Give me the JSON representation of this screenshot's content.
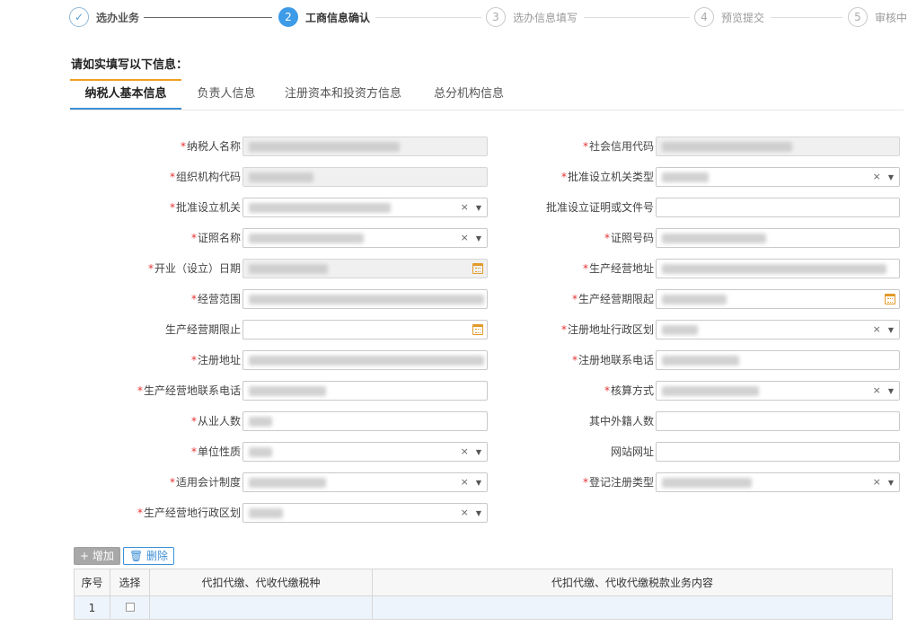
{
  "stepper": {
    "steps": [
      {
        "index": "✓",
        "label": "选办业务",
        "state": "done"
      },
      {
        "index": "2",
        "label": "工商信息确认",
        "state": "active"
      },
      {
        "index": "3",
        "label": "选办信息填写",
        "state": "pending"
      },
      {
        "index": "4",
        "label": "预览提交",
        "state": "pending"
      },
      {
        "index": "5",
        "label": "审核中",
        "state": "pending"
      }
    ]
  },
  "form_title": "请如实填写以下信息：",
  "tabs": [
    {
      "label": "纳税人基本信息",
      "active": true
    },
    {
      "label": "负责人信息",
      "active": false
    },
    {
      "label": "注册资本和投资方信息",
      "active": false
    },
    {
      "label": "总分机构信息",
      "active": false
    }
  ],
  "fields": {
    "taxpayer_name": {
      "label": "纳税人名称",
      "required": true,
      "type": "text",
      "disabled": true
    },
    "credit_code": {
      "label": "社会信用代码",
      "required": true,
      "type": "text",
      "disabled": true
    },
    "org_code": {
      "label": "组织机构代码",
      "required": true,
      "type": "text",
      "disabled": true
    },
    "approval_org_type": {
      "label": "批准设立机关类型",
      "required": true,
      "type": "select"
    },
    "approval_org": {
      "label": "批准设立机关",
      "required": true,
      "type": "select"
    },
    "approval_doc_no": {
      "label": "批准设立证明或文件号",
      "required": false,
      "type": "text"
    },
    "license_name": {
      "label": "证照名称",
      "required": true,
      "type": "select"
    },
    "license_no": {
      "label": "证照号码",
      "required": true,
      "type": "text"
    },
    "open_date": {
      "label": "开业（设立）日期",
      "required": true,
      "type": "date",
      "disabled": true
    },
    "business_address": {
      "label": "生产经营地址",
      "required": true,
      "type": "text"
    },
    "business_scope": {
      "label": "经营范围",
      "required": true,
      "type": "text"
    },
    "period_start": {
      "label": "生产经营期限起",
      "required": true,
      "type": "date"
    },
    "period_end": {
      "label": "生产经营期限止",
      "required": false,
      "type": "date"
    },
    "reg_region": {
      "label": "注册地址行政区划",
      "required": true,
      "type": "select"
    },
    "reg_address": {
      "label": "注册地址",
      "required": true,
      "type": "text"
    },
    "reg_phone": {
      "label": "注册地联系电话",
      "required": true,
      "type": "text"
    },
    "business_phone": {
      "label": "生产经营地联系电话",
      "required": true,
      "type": "text"
    },
    "accounting_method": {
      "label": "核算方式",
      "required": true,
      "type": "select"
    },
    "employees": {
      "label": "从业人数",
      "required": true,
      "type": "text"
    },
    "foreign_employees": {
      "label": "其中外籍人数",
      "required": false,
      "type": "text"
    },
    "unit_nature": {
      "label": "单位性质",
      "required": true,
      "type": "select"
    },
    "website": {
      "label": "网站网址",
      "required": false,
      "type": "text"
    },
    "accounting_system": {
      "label": "适用会计制度",
      "required": true,
      "type": "select"
    },
    "registration_type": {
      "label": "登记注册类型",
      "required": true,
      "type": "select"
    },
    "business_region": {
      "label": "生产经营地行政区划",
      "required": true,
      "type": "select"
    }
  },
  "table_toolbar": {
    "add_label": "+ 增加",
    "delete_label": "🗑 删除"
  },
  "table": {
    "columns": [
      "序号",
      "选择",
      "代扣代缴、代收代缴税种",
      "代扣代缴、代收代缴税款业务内容"
    ],
    "rows": [
      [
        "1",
        "",
        "",
        ""
      ]
    ]
  },
  "colors": {
    "accent": "#3d9be8",
    "tab_top": "#f0a020",
    "required": "#e53333",
    "calendar": "#e29a2a"
  }
}
